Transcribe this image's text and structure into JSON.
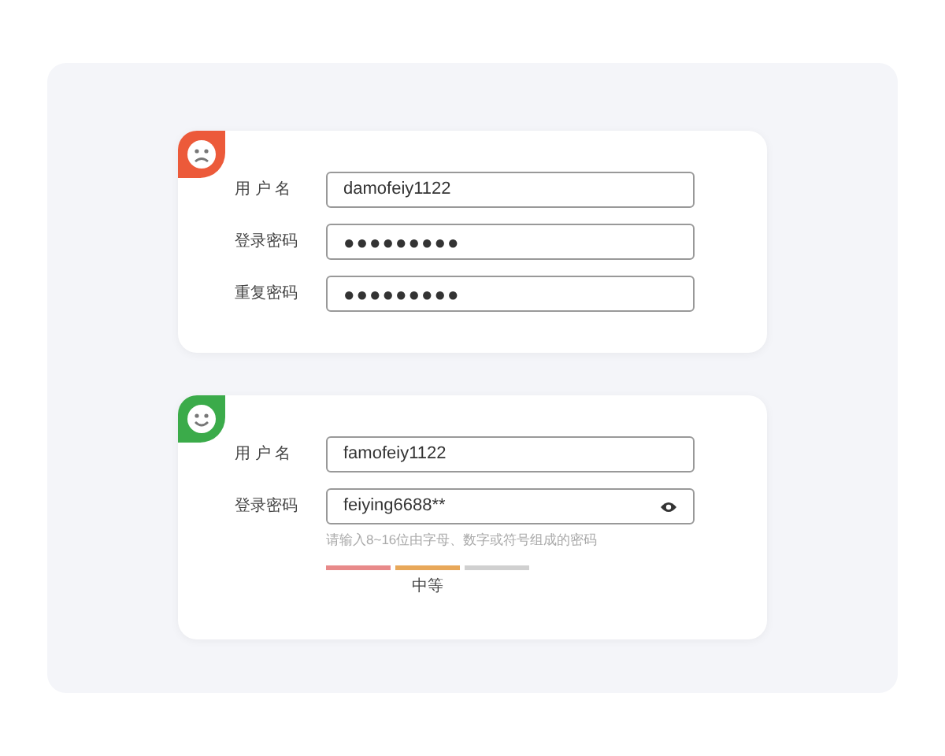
{
  "cards": [
    {
      "kind": "sad",
      "fields": [
        {
          "label": "用 户 名",
          "value": "damofeiy1122",
          "kind": "text"
        },
        {
          "label": "登录密码",
          "value": "●●●●●●●●●",
          "kind": "masked"
        },
        {
          "label": "重复密码",
          "value": "●●●●●●●●●",
          "kind": "masked"
        }
      ]
    },
    {
      "kind": "happy",
      "fields": [
        {
          "label": "用 户 名",
          "value": "famofeiy1122",
          "kind": "text"
        },
        {
          "label": "登录密码",
          "value": "feiying6688**",
          "kind": "revealed",
          "hint": "请输入8~16位由字母、数字或符号组成的密码",
          "strength": {
            "segments": [
              {
                "color": "#e88a8a"
              },
              {
                "color": "#e8a85a"
              },
              {
                "color": "#d0d0d0"
              }
            ],
            "label": "中等"
          }
        }
      ]
    }
  ]
}
